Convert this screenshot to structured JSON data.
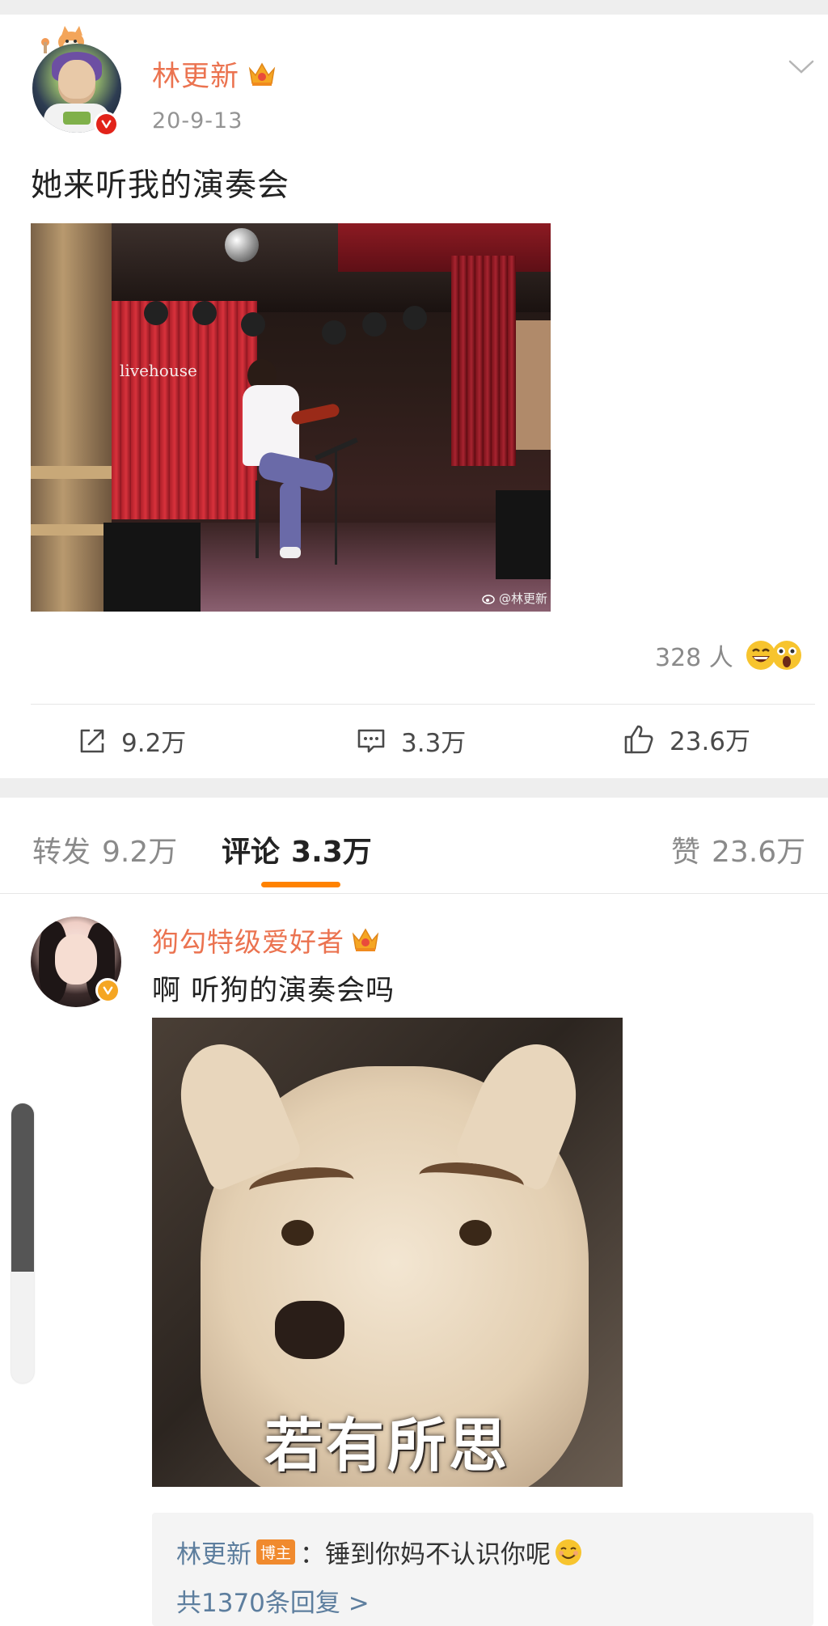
{
  "post": {
    "author": "林更新",
    "time": "20-9-13",
    "text": "她来听我的演奏会",
    "image": {
      "signage": "livehouse",
      "watermark": "@林更新"
    },
    "reactions_count": "328 人",
    "actions": {
      "repost": "9.2万",
      "comment": "3.3万",
      "like": "23.6万"
    }
  },
  "tabs": {
    "repost": {
      "label": "转发",
      "count": "9.2万"
    },
    "comment": {
      "label": "评论",
      "count": "3.3万"
    },
    "like": {
      "label": "赞",
      "count": "23.6万"
    }
  },
  "comment": {
    "author": "狗勾特级爱好者",
    "text": "啊 听狗的演奏会吗",
    "image_caption": "若有所思",
    "reply": {
      "author": "林更新",
      "badge": "博主",
      "text": "：锤到你妈不认识你呢",
      "more": "共1370条回复 >"
    }
  },
  "colors": {
    "username": "#eb7350",
    "accent": "#ff8200",
    "link": "#5d7e9e"
  }
}
